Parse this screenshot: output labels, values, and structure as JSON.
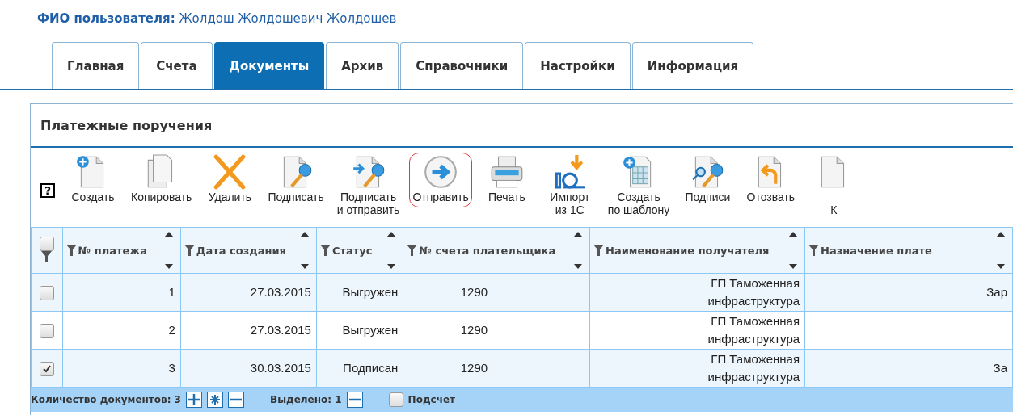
{
  "user": {
    "label": "ФИО пользователя:",
    "name": "Жолдош Жолдошевич Жолдошев"
  },
  "tabs": [
    {
      "label": "Главная",
      "selected": false
    },
    {
      "label": "Счета",
      "selected": false
    },
    {
      "label": "Документы",
      "selected": true
    },
    {
      "label": "Архив",
      "selected": false
    },
    {
      "label": "Справочники",
      "selected": false
    },
    {
      "label": "Настройки",
      "selected": false
    },
    {
      "label": "Информация",
      "selected": false
    }
  ],
  "panel": {
    "title": "Платежные поручения"
  },
  "toolbar": {
    "help": "?",
    "buttons": [
      {
        "label": "Создать",
        "highlighted": false
      },
      {
        "label": "Копировать",
        "highlighted": false
      },
      {
        "label": "Удалить",
        "highlighted": false
      },
      {
        "label": "Подписать",
        "highlighted": false
      },
      {
        "label": "Подписать\nи отправить",
        "highlighted": false
      },
      {
        "label": "Отправить",
        "highlighted": true
      },
      {
        "label": "Печать",
        "highlighted": false
      },
      {
        "label": "Импорт\nиз 1С",
        "highlighted": false
      },
      {
        "label": "Создать\nпо шаблону",
        "highlighted": false
      },
      {
        "label": "Подписи",
        "highlighted": false
      },
      {
        "label": "Отозвать",
        "highlighted": false
      },
      {
        "label": "\nК",
        "highlighted": false
      }
    ]
  },
  "table": {
    "columns": [
      "№ платежа",
      "Дата создания",
      "Статус",
      "№ счета плательщика",
      "Наименование получателя",
      "Назначение плате"
    ],
    "all_checked": false,
    "rows": [
      {
        "checked": false,
        "cells": [
          "1",
          "27.03.2015",
          "Выгружен",
          "1290",
          "ГП Таможенная инфраструктура",
          "Зар"
        ]
      },
      {
        "checked": false,
        "cells": [
          "2",
          "27.03.2015",
          "Выгружен",
          "1290",
          "ГП Таможенная инфраструктура",
          ""
        ]
      },
      {
        "checked": true,
        "cells": [
          "3",
          "30.03.2015",
          "Подписан",
          "1290",
          "ГП Таможенная инфраструктура",
          "За"
        ]
      }
    ]
  },
  "footer": {
    "count": "Количество документов: 3",
    "selected": "Выделено: 1",
    "sum_label": "Подсчет",
    "sum_checked": false
  }
}
